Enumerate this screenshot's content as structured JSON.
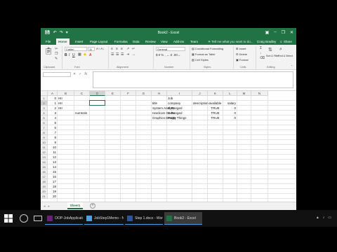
{
  "window": {
    "title": "Book2 - Excel",
    "qat_icons": [
      "save-icon",
      "undo-icon",
      "redo-icon",
      "customize-icon"
    ]
  },
  "ribbon_tabs": [
    "File",
    "Home",
    "Insert",
    "Page Layout",
    "Formulas",
    "Data",
    "Review",
    "View",
    "Add-ins",
    "Team"
  ],
  "active_tab": "Home",
  "tell_me": "Tell me what you want to do...",
  "user": "Craig Bradley",
  "share": "Share",
  "ribbon": {
    "font_name": "Calibri",
    "font_size": "11",
    "number_format": "General",
    "conditional_formatting": "Conditional Formatting",
    "format_as_table": "Format as Table",
    "cell_styles": "Cell Styles",
    "insert": "Insert",
    "delete": "Delete",
    "format": "Format",
    "sort_filter": "Sort & Filter",
    "find_select": "Find & Select",
    "groups": [
      "Clipboard",
      "Font",
      "Alignment",
      "Number",
      "Styles",
      "Cells",
      "Editing"
    ]
  },
  "formula_bar": {
    "name_box": "",
    "content": ""
  },
  "columns": [
    "A",
    "B",
    "C",
    "D",
    "E",
    "F",
    "G",
    "H",
    "I",
    "J",
    "K",
    "L",
    "M",
    "N"
  ],
  "selected_column": "D",
  "rows": [
    "1",
    "2",
    "3",
    "4",
    "5",
    "6",
    "7",
    "8",
    "9",
    "10",
    "11",
    "12",
    "13",
    "14",
    "15",
    "16",
    "17",
    "18",
    "19",
    "20",
    "21"
  ],
  "selected_row": "2",
  "cells": {
    "A1": "0",
    "B1": "HII",
    "A2": "1",
    "B2": "HII",
    "A3": "2",
    "B3": "HII",
    "A4": "3",
    "C4": "numtotin",
    "A5": "4",
    "A6": "5",
    "A7": "6",
    "A8": "7",
    "A9": "8",
    "A10": "9",
    "A11": "10",
    "A12": "11",
    "A13": "12",
    "A14": "13",
    "A15": "14",
    "A16": "15",
    "A17": "16",
    "A18": "17",
    "A19": "18",
    "A20": "19",
    "A21": "20",
    "I1": "Job",
    "H2": "title",
    "I2": "company",
    "J2": "description",
    "K2": "available",
    "L2": "salary",
    "H3": "System Analyst",
    "I3": "D-Ranged",
    "K3": "TRUE",
    "L3": "0",
    "H4": "Hardcore Coder",
    "I4": "D-Ranged",
    "K4": "TRUE",
    "L4": "0",
    "H5": "Graphics Design",
    "I5": "Pretty Things",
    "K5": "TRUE",
    "L5": "0"
  },
  "sheet_tabs": [
    "Sheet1"
  ],
  "status": {
    "ready": "Ready",
    "zoom": "100%"
  },
  "taskbar": {
    "apps": [
      {
        "label": "OOP-JobApplicationS...",
        "icon": "ide-icon",
        "active": false
      },
      {
        "label": "JobStep1Memo - Not...",
        "icon": "notepad-icon",
        "active": false
      },
      {
        "label": "Step 1.docx - Word",
        "icon": "word-icon",
        "active": false
      },
      {
        "label": "Book2 - Excel",
        "icon": "excel-icon",
        "active": true
      }
    ]
  },
  "colors": {
    "excel_green": "#217346",
    "ribbon_bg": "#f3f3f3",
    "taskbar_bg": "#111111",
    "accent_blue": "#4a9ede"
  }
}
